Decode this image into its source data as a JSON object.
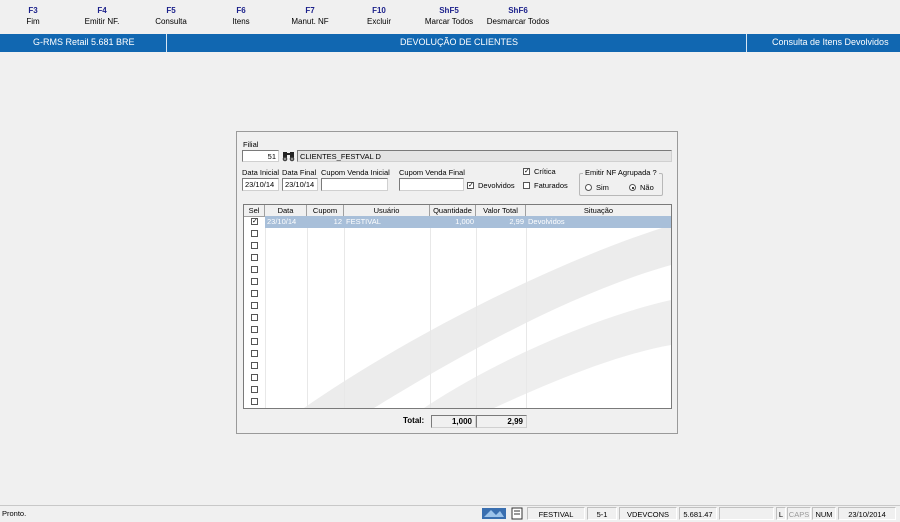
{
  "toolbar": {
    "keys": [
      {
        "key": "F3",
        "label": "Fim"
      },
      {
        "key": "F4",
        "label": "Emitir NF."
      },
      {
        "key": "F5",
        "label": "Consulta"
      },
      {
        "key": "F6",
        "label": "Itens"
      },
      {
        "key": "F7",
        "label": "Manut. NF"
      },
      {
        "key": "F10",
        "label": "Excluir"
      },
      {
        "key": "ShF5",
        "label": "Marcar Todos"
      },
      {
        "key": "ShF6",
        "label": "Desmarcar Todos"
      }
    ]
  },
  "titlebar": {
    "app": "G-RMS Retail 5.681 BRE",
    "screen": "DEVOLUÇÃO DE CLIENTES",
    "context": "Consulta de Itens Devolvidos"
  },
  "form": {
    "filial_label": "Filial",
    "filial_value": "51",
    "filial_name": "CLIENTES_FESTVAL D",
    "data_inicial_label": "Data Inicial",
    "data_inicial_value": "23/10/14",
    "data_final_label": "Data Final",
    "data_final_value": "23/10/14",
    "cupom_inicial_label": "Cupom Venda Inicial",
    "cupom_inicial_value": "",
    "cupom_final_label": "Cupom Venda Final",
    "cupom_final_value": "",
    "devolvidos_label": "Devolvidos",
    "devolvidos_checked": true,
    "critica_label": "Crítica",
    "critica_checked": true,
    "faturados_label": "Faturados",
    "faturados_checked": false,
    "emitir_group_label": "Emitir NF Agrupada ?",
    "sim_label": "Sim",
    "nao_label": "Não",
    "emitir_selected": "Não"
  },
  "grid": {
    "columns": [
      "Sel",
      "Data",
      "Cupom",
      "Usuário",
      "Quantidade",
      "Valor Total",
      "Situação"
    ],
    "rows": [
      {
        "sel": true,
        "data": "23/10/14",
        "cupom": "12",
        "usuario": "FESTIVAL",
        "quantidade": "1,000",
        "valor_total": "2,99",
        "situacao": "Devolvidos"
      }
    ],
    "empty_rows": 15
  },
  "totals": {
    "label": "Total:",
    "quantidade": "1,000",
    "valor": "2,99"
  },
  "statusbar": {
    "message": "Pronto.",
    "user": "FESTIVAL",
    "loja": "5-1",
    "program": "VDEVCONS",
    "version": "5.681.47",
    "l": "L",
    "caps": "CAPS",
    "num": "NUM",
    "date": "23/10/2014"
  }
}
